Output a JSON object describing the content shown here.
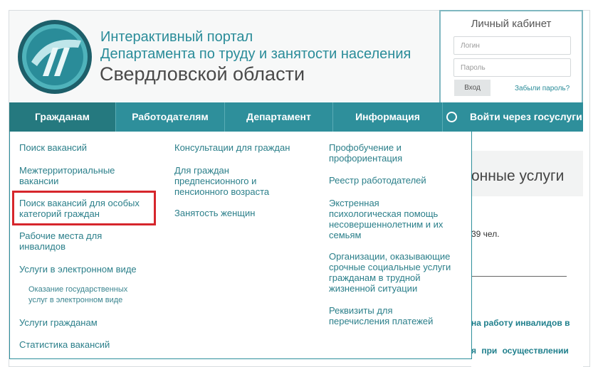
{
  "header": {
    "title_line1": "Интерактивный портал",
    "title_line2": "Департамента по труду и занятости населения",
    "title_line3": "Свердловской области",
    "logo_icon": "portal-logo"
  },
  "cabinet": {
    "title": "Личный кабинет",
    "login_placeholder": "Логин",
    "password_placeholder": "Пароль",
    "login_button": "Вход",
    "forgot_link": "Забыли пароль?"
  },
  "nav": {
    "items": [
      {
        "label": "Гражданам",
        "active": true
      },
      {
        "label": "Работодателям"
      },
      {
        "label": "Департамент"
      },
      {
        "label": "Информация"
      }
    ],
    "gosuslugi_label": "Войти через госуслуги"
  },
  "dropdown": {
    "col1": [
      {
        "label": "Поиск вакансий"
      },
      {
        "label": "Межтерриториальные\nвакансии"
      },
      {
        "label": "Поиск вакансий для особых\nкатегорий граждан",
        "highlighted": true
      },
      {
        "label": "Рабочие места для\nинвалидов"
      },
      {
        "label": "Услуги в электронном виде"
      },
      {
        "label": "Оказание государственных\nуслуг в электронном виде"
      },
      {
        "label": "Услуги гражданам"
      },
      {
        "label": "Статистика вакансий"
      }
    ],
    "col2": [
      {
        "label": "Консультации для граждан"
      },
      {
        "label": "Для граждан\nпредпенсионного и\nпенсионного возраста"
      },
      {
        "label": "Занятость женщин"
      }
    ],
    "col3": [
      {
        "label": "Профобучение и\nпрофориентация"
      },
      {
        "label": "Реестр работодателей"
      },
      {
        "label": "Экстренная\nпсихологическая помощь\nнесовершеннолетним и их\nсемьям"
      },
      {
        "label": "Организации, оказывающие\nсрочные социальные услуги\nгражданам в трудной\nжизненной ситуации"
      },
      {
        "label": "Реквизиты для\nперечисления платежей"
      }
    ]
  },
  "background": {
    "services_heading": "онные услуги",
    "count_text": "39 чел.",
    "link1": "на работу инвалидов в",
    "link2": "я при осуществлении"
  },
  "colors": {
    "accent": "#2e8f9b",
    "nav_active": "#25797f",
    "link": "#2b7f8a",
    "highlight": "#d6262c"
  }
}
